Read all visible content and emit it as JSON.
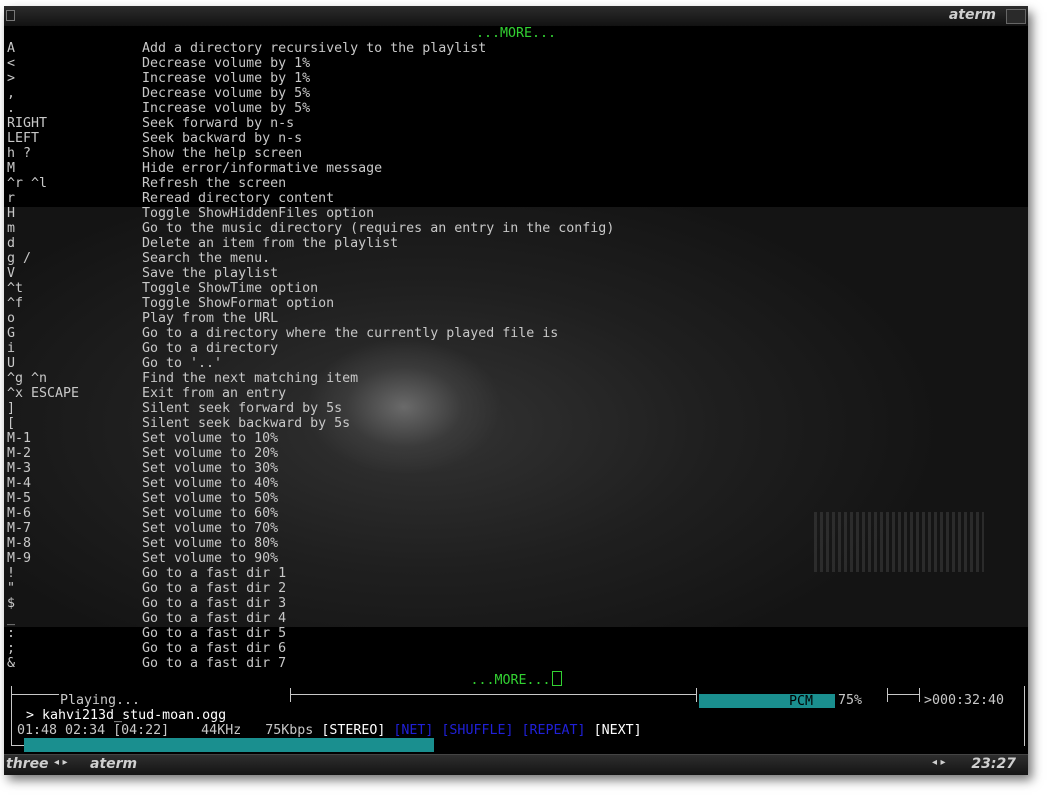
{
  "window": {
    "title": "aterm"
  },
  "more_top": "...MORE...",
  "more_bottom": "...MORE...",
  "help": [
    {
      "key": "A",
      "desc": "Add a directory recursively to the playlist"
    },
    {
      "key": "<",
      "desc": "Decrease volume by 1%"
    },
    {
      "key": ">",
      "desc": "Increase volume by 1%"
    },
    {
      "key": ",",
      "desc": "Decrease volume by 5%"
    },
    {
      "key": ".",
      "desc": "Increase volume by 5%"
    },
    {
      "key": "RIGHT",
      "desc": "Seek forward by n-s"
    },
    {
      "key": "LEFT",
      "desc": "Seek backward by n-s"
    },
    {
      "key": "h ?",
      "desc": "Show the help screen"
    },
    {
      "key": "M",
      "desc": "Hide error/informative message"
    },
    {
      "key": "^r ^l",
      "desc": "Refresh the screen"
    },
    {
      "key": "r",
      "desc": "Reread directory content"
    },
    {
      "key": "H",
      "desc": "Toggle ShowHiddenFiles option"
    },
    {
      "key": "m",
      "desc": "Go to the music directory (requires an entry in the config)"
    },
    {
      "key": "d",
      "desc": "Delete an item from the playlist"
    },
    {
      "key": "g /",
      "desc": "Search the menu."
    },
    {
      "key": "V",
      "desc": "Save the playlist"
    },
    {
      "key": "^t",
      "desc": "Toggle ShowTime option"
    },
    {
      "key": "^f",
      "desc": "Toggle ShowFormat option"
    },
    {
      "key": "o",
      "desc": "Play from the URL"
    },
    {
      "key": "G",
      "desc": "Go to a directory where the currently played file is"
    },
    {
      "key": "i",
      "desc": "Go to a directory"
    },
    {
      "key": "U",
      "desc": "Go to '..'"
    },
    {
      "key": "^g ^n",
      "desc": "Find the next matching item"
    },
    {
      "key": "^x ESCAPE",
      "desc": "Exit from an entry"
    },
    {
      "key": "]",
      "desc": "Silent seek forward by 5s"
    },
    {
      "key": "[",
      "desc": "Silent seek backward by 5s"
    },
    {
      "key": "M-1",
      "desc": "Set volume to 10%"
    },
    {
      "key": "M-2",
      "desc": "Set volume to 20%"
    },
    {
      "key": "M-3",
      "desc": "Set volume to 30%"
    },
    {
      "key": "M-4",
      "desc": "Set volume to 40%"
    },
    {
      "key": "M-5",
      "desc": "Set volume to 50%"
    },
    {
      "key": "M-6",
      "desc": "Set volume to 60%"
    },
    {
      "key": "M-7",
      "desc": "Set volume to 70%"
    },
    {
      "key": "M-8",
      "desc": "Set volume to 80%"
    },
    {
      "key": "M-9",
      "desc": "Set volume to 90%"
    },
    {
      "key": "!",
      "desc": "Go to a fast dir 1"
    },
    {
      "key": "\"",
      "desc": "Go to a fast dir 2"
    },
    {
      "key": "$",
      "desc": "Go to a fast dir 3"
    },
    {
      "key": "_",
      "desc": "Go to a fast dir 4"
    },
    {
      "key": ":",
      "desc": "Go to a fast dir 5"
    },
    {
      "key": ";",
      "desc": "Go to a fast dir 6"
    },
    {
      "key": "&",
      "desc": "Go to a fast dir 7"
    }
  ],
  "status": {
    "state": "Playing...",
    "volume_label": "PCM",
    "volume_percent": "75%",
    "volume_level": 0.75,
    "remaining": ">000:32:40",
    "file": "> kahvi213d_stud-moan.ogg",
    "time_played": "01:48",
    "time_left": "02:34",
    "time_total": "[04:22]",
    "rate": "44",
    "rate_unit": "KHz",
    "bitrate": "75",
    "bitrate_unit": "Kbps",
    "stereo": "[STEREO]",
    "net": "[NET]",
    "shuffle": "[SHUFFLE]",
    "repeat": "[REPEAT]",
    "next": "[NEXT]",
    "progress": 0.41
  },
  "taskbar": {
    "workspace": "three",
    "arrows": "◂ ▸",
    "task": "aterm",
    "clock": "23:27"
  },
  "colors": {
    "accent": "#1a8f8f",
    "more": "#32d132",
    "inactive_flag": "#2020d8"
  }
}
